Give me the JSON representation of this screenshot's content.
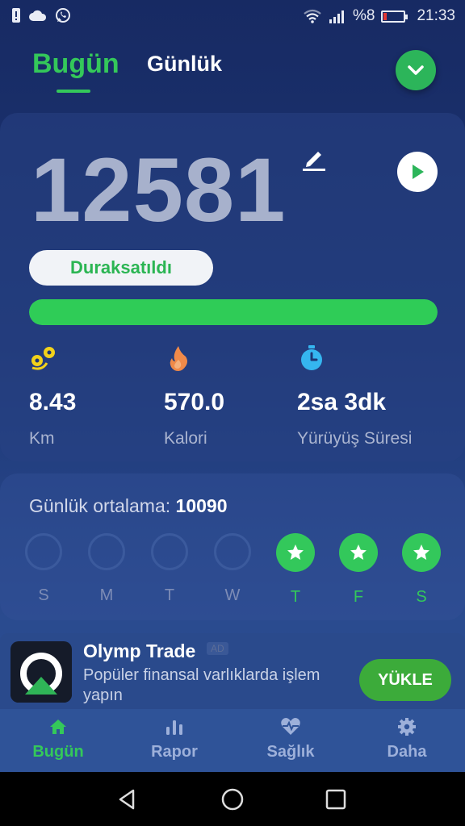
{
  "status_bar": {
    "battery_pct": "%8",
    "time": "21:33"
  },
  "header": {
    "tab_today": "Bugün",
    "tab_daily": "Günlük"
  },
  "main": {
    "steps": "12581",
    "status_pill": "Duraksatıldı",
    "progress": 1.0,
    "stats": [
      {
        "icon": "distance-icon",
        "value": "8.43",
        "label": "Km"
      },
      {
        "icon": "flame-icon",
        "value": "570.0",
        "label": "Kalori"
      },
      {
        "icon": "stopwatch-icon",
        "value": "2sa 3dk",
        "label": "Yürüyüş Süresi"
      }
    ]
  },
  "weekly": {
    "avg_label": "Günlük ortalama:",
    "avg_value": "10090",
    "days": [
      {
        "label": "S",
        "done": false
      },
      {
        "label": "M",
        "done": false
      },
      {
        "label": "T",
        "done": false
      },
      {
        "label": "W",
        "done": false
      },
      {
        "label": "T",
        "done": true
      },
      {
        "label": "F",
        "done": true
      },
      {
        "label": "S",
        "done": true
      }
    ]
  },
  "ad": {
    "title": "Olymp Trade",
    "badge": "AD",
    "description": "Popüler finansal varlıklarda işlem yapın",
    "button": "YÜKLE"
  },
  "bottom_nav": [
    {
      "label": "Bugün",
      "icon": "home-icon",
      "active": true
    },
    {
      "label": "Rapor",
      "icon": "bar-chart-icon",
      "active": false
    },
    {
      "label": "Sağlık",
      "icon": "heart-pulse-icon",
      "active": false
    },
    {
      "label": "Daha",
      "icon": "settings-icon",
      "active": false
    }
  ],
  "colors": {
    "accent": "#34c85a",
    "background": "#1d3675",
    "steps_text": "#a7b1cc"
  }
}
